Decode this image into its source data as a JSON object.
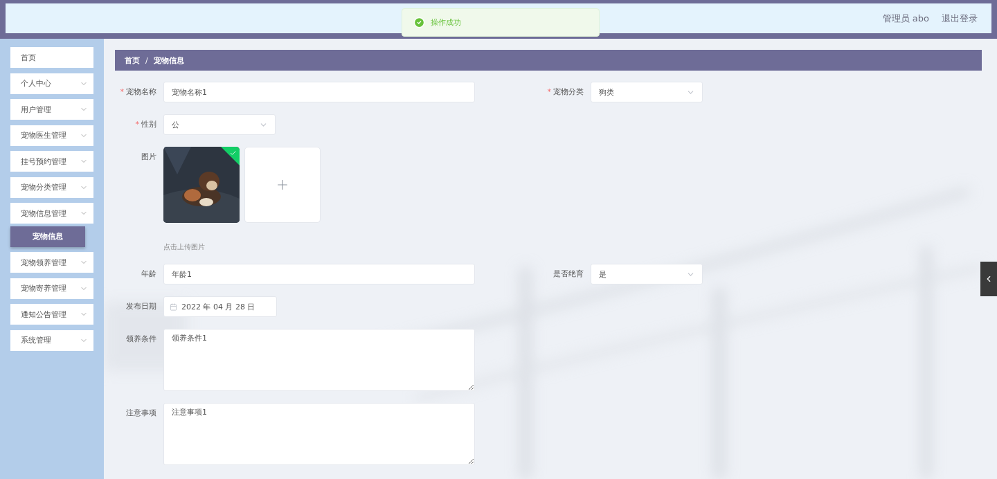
{
  "toast": {
    "kind": "success",
    "message": "操作成功"
  },
  "header": {
    "user_label": "管理员 abo",
    "logout": "退出登录"
  },
  "sidebar": {
    "items": [
      {
        "label": "首页",
        "kind": "link",
        "selected": false
      },
      {
        "label": "个人中心",
        "kind": "submenu",
        "selected": false
      },
      {
        "label": "用户管理",
        "kind": "submenu",
        "selected": false
      },
      {
        "label": "宠物医生管理",
        "kind": "submenu",
        "selected": false
      },
      {
        "label": "挂号预约管理",
        "kind": "submenu",
        "selected": false
      },
      {
        "label": "宠物分类管理",
        "kind": "submenu",
        "selected": false
      },
      {
        "label": "宠物信息管理",
        "kind": "submenu",
        "selected": false,
        "children": [
          {
            "label": "宠物信息",
            "selected": true
          }
        ]
      },
      {
        "label": "宠物领养管理",
        "kind": "submenu",
        "selected": false
      },
      {
        "label": "宠物寄养管理",
        "kind": "submenu",
        "selected": false
      },
      {
        "label": "通知公告管理",
        "kind": "submenu",
        "selected": false
      },
      {
        "label": "系统管理",
        "kind": "submenu",
        "selected": false
      }
    ]
  },
  "breadcrumb": {
    "items": [
      "首页",
      "宠物信息"
    ],
    "separator": "/"
  },
  "form": {
    "rows": [
      [
        {
          "kind": "input",
          "required_mark": "*",
          "label": "宠物名称",
          "value": "宠物名称1"
        },
        {
          "kind": "select",
          "required_mark": "*",
          "label": "宠物分类",
          "value": "狗类"
        }
      ],
      [
        {
          "kind": "select",
          "required_mark": "*",
          "label": "性别",
          "value": "公"
        }
      ],
      [
        {
          "kind": "upload",
          "label": "图片",
          "images": [
            {
              "kind": "picture",
              "uploaded": true
            }
          ],
          "hint": "点击上传图片"
        }
      ],
      [
        {
          "kind": "input",
          "label": "年龄",
          "value": "年龄1"
        },
        {
          "kind": "select",
          "label": "是否绝育",
          "value": "是"
        }
      ],
      [
        {
          "kind": "date",
          "label": "发布日期",
          "value": "2022 年 04 月 28 日"
        }
      ],
      [
        {
          "kind": "textarea",
          "label": "领养条件",
          "value": "领养条件1"
        }
      ],
      [
        {
          "kind": "textarea",
          "label": "注意事项",
          "value": "注意事项1"
        }
      ]
    ]
  }
}
